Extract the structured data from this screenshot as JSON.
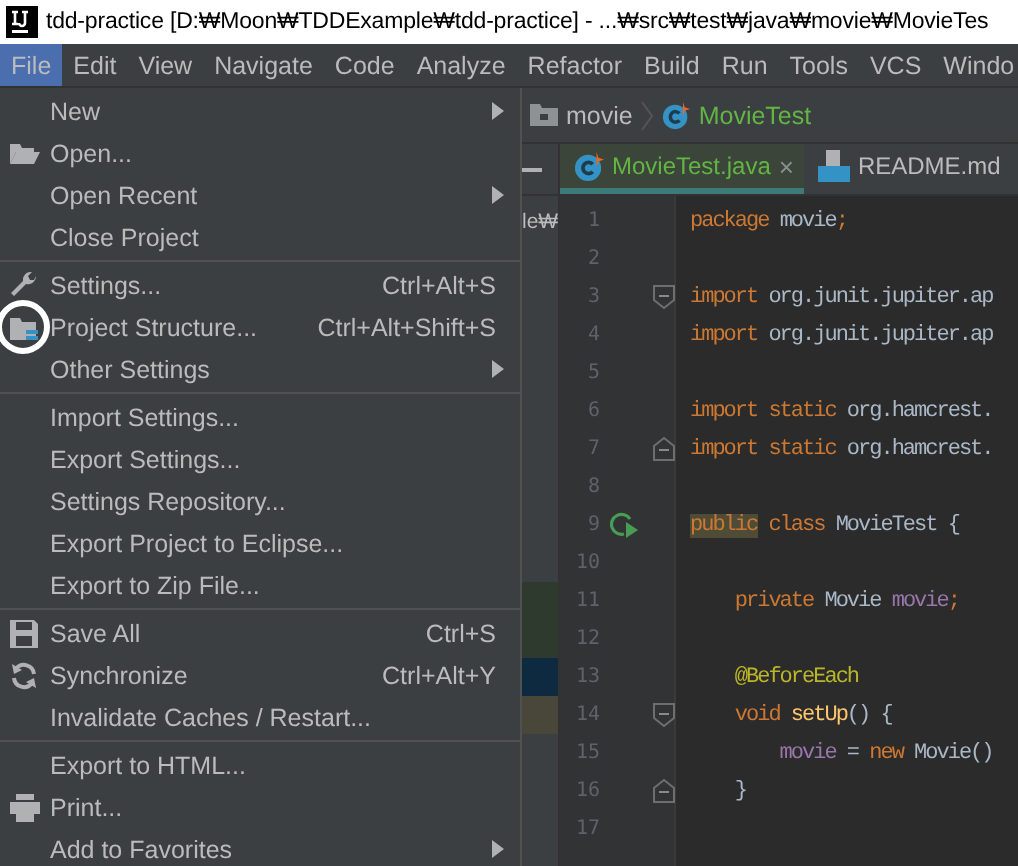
{
  "window": {
    "title": "tdd-practice [D:₩Moon₩TDDExample₩tdd-practice] - ...₩src₩test₩java₩movie₩MovieTes"
  },
  "menu_bar": [
    {
      "label": "File",
      "selected": true
    },
    {
      "label": "Edit",
      "selected": false
    },
    {
      "label": "View",
      "selected": false
    },
    {
      "label": "Navigate",
      "selected": false
    },
    {
      "label": "Code",
      "selected": false
    },
    {
      "label": "Analyze",
      "selected": false
    },
    {
      "label": "Refactor",
      "selected": false
    },
    {
      "label": "Build",
      "selected": false
    },
    {
      "label": "Run",
      "selected": false
    },
    {
      "label": "Tools",
      "selected": false
    },
    {
      "label": "VCS",
      "selected": false
    },
    {
      "label": "Windo",
      "selected": false
    }
  ],
  "file_menu": [
    [
      {
        "label": "New",
        "submenu": true,
        "circled": false
      },
      {
        "label": "Open...",
        "submenu": false,
        "circled": false
      },
      {
        "label": "Open Recent",
        "submenu": true,
        "circled": false
      },
      {
        "label": "Close Project",
        "submenu": false,
        "circled": false
      }
    ],
    [
      {
        "label": "Settings...",
        "shortcut": "Ctrl+Alt+S",
        "submenu": false,
        "circled": false
      },
      {
        "label": "Project Structure...",
        "shortcut": "Ctrl+Alt+Shift+S",
        "submenu": false,
        "circled": true
      },
      {
        "label": "Other Settings",
        "submenu": true,
        "circled": false
      }
    ],
    [
      {
        "label": "Import Settings...",
        "submenu": false,
        "circled": false
      },
      {
        "label": "Export Settings...",
        "submenu": false,
        "circled": false
      },
      {
        "label": "Settings Repository...",
        "submenu": false,
        "circled": false
      },
      {
        "label": "Export Project to Eclipse...",
        "submenu": false,
        "circled": false
      },
      {
        "label": "Export to Zip File...",
        "submenu": false,
        "circled": false
      }
    ],
    [
      {
        "label": "Save All",
        "shortcut": "Ctrl+S",
        "submenu": false,
        "circled": false
      },
      {
        "label": "Synchronize",
        "shortcut": "Ctrl+Alt+Y",
        "submenu": false,
        "circled": false
      },
      {
        "label": "Invalidate Caches / Restart...",
        "submenu": false,
        "circled": false
      }
    ],
    [
      {
        "label": "Export to HTML...",
        "submenu": false,
        "circled": false
      },
      {
        "label": "Print...",
        "submenu": false,
        "circled": false
      },
      {
        "label": "Add to Favorites",
        "submenu": true,
        "circled": false
      }
    ]
  ],
  "breadcrumb": [
    "movie",
    "MovieTest"
  ],
  "project_panel": {
    "visible_text": "le₩"
  },
  "tabs": [
    {
      "label": "MovieTest.java",
      "selected": true,
      "close_glyph": "×"
    },
    {
      "label": "README.md",
      "selected": false
    }
  ],
  "editor": {
    "lines": [
      {
        "number": "1",
        "fold_start": false,
        "fold_end": false,
        "run": false,
        "tokens": [
          {
            "text": "package",
            "kind": "keyword"
          },
          {
            "text": " movie",
            "kind": "plain"
          },
          {
            "text": ";",
            "kind": "keyword"
          }
        ]
      },
      {
        "number": "2",
        "fold_start": false,
        "fold_end": false,
        "run": false
      },
      {
        "number": "3",
        "fold_start": true,
        "fold_end": false,
        "run": false,
        "tokens": [
          {
            "text": "import",
            "kind": "keyword"
          },
          {
            "text": " org.junit.jupiter.ap",
            "kind": "plain"
          }
        ]
      },
      {
        "number": "4",
        "fold_start": false,
        "fold_end": false,
        "run": false,
        "tokens": [
          {
            "text": "import",
            "kind": "keyword"
          },
          {
            "text": " org.junit.jupiter.ap",
            "kind": "plain"
          }
        ]
      },
      {
        "number": "5",
        "fold_start": false,
        "fold_end": false,
        "run": false
      },
      {
        "number": "6",
        "fold_start": false,
        "fold_end": false,
        "run": false,
        "tokens": [
          {
            "text": "import static",
            "kind": "keyword"
          },
          {
            "text": " org.hamcrest.",
            "kind": "plain"
          }
        ]
      },
      {
        "number": "7",
        "fold_start": false,
        "fold_end": true,
        "run": false,
        "tokens": [
          {
            "text": "import static",
            "kind": "keyword"
          },
          {
            "text": " org.hamcrest.",
            "kind": "plain"
          }
        ]
      },
      {
        "number": "8",
        "fold_start": false,
        "fold_end": false,
        "run": false
      },
      {
        "number": "9",
        "fold_start": false,
        "fold_end": false,
        "run": true,
        "tokens": [
          {
            "text": "public",
            "kind": "keyword",
            "highlighted": true
          },
          {
            "text": " class",
            "kind": "keyword"
          },
          {
            "text": " MovieTest {",
            "kind": "plain"
          }
        ]
      },
      {
        "number": "10",
        "fold_start": false,
        "fold_end": false,
        "run": false
      },
      {
        "number": "11",
        "fold_start": false,
        "fold_end": false,
        "run": false,
        "tokens": [
          {
            "text": "    private",
            "kind": "keyword"
          },
          {
            "text": " Movie ",
            "kind": "plain"
          },
          {
            "text": "movie",
            "kind": "field"
          },
          {
            "text": ";",
            "kind": "keyword"
          }
        ]
      },
      {
        "number": "12",
        "fold_start": false,
        "fold_end": false,
        "run": false
      },
      {
        "number": "13",
        "fold_start": false,
        "fold_end": false,
        "run": false,
        "tokens": [
          {
            "text": "    @BeforeEach",
            "kind": "annotation"
          }
        ]
      },
      {
        "number": "14",
        "fold_start": true,
        "fold_end": false,
        "run": false,
        "tokens": [
          {
            "text": "    void",
            "kind": "keyword"
          },
          {
            "text": " setUp",
            "kind": "method"
          },
          {
            "text": "() {",
            "kind": "plain"
          }
        ]
      },
      {
        "number": "15",
        "fold_start": false,
        "fold_end": false,
        "run": false,
        "tokens": [
          {
            "text": "        movie",
            "kind": "field"
          },
          {
            "text": " = ",
            "kind": "plain"
          },
          {
            "text": "new",
            "kind": "keyword"
          },
          {
            "text": " Movie()",
            "kind": "plain"
          }
        ]
      },
      {
        "number": "16",
        "fold_start": false,
        "fold_end": true,
        "run": false,
        "tokens": [
          {
            "text": "    }",
            "kind": "plain"
          }
        ]
      },
      {
        "number": "17",
        "fold_start": false,
        "fold_end": false,
        "run": false
      }
    ]
  }
}
